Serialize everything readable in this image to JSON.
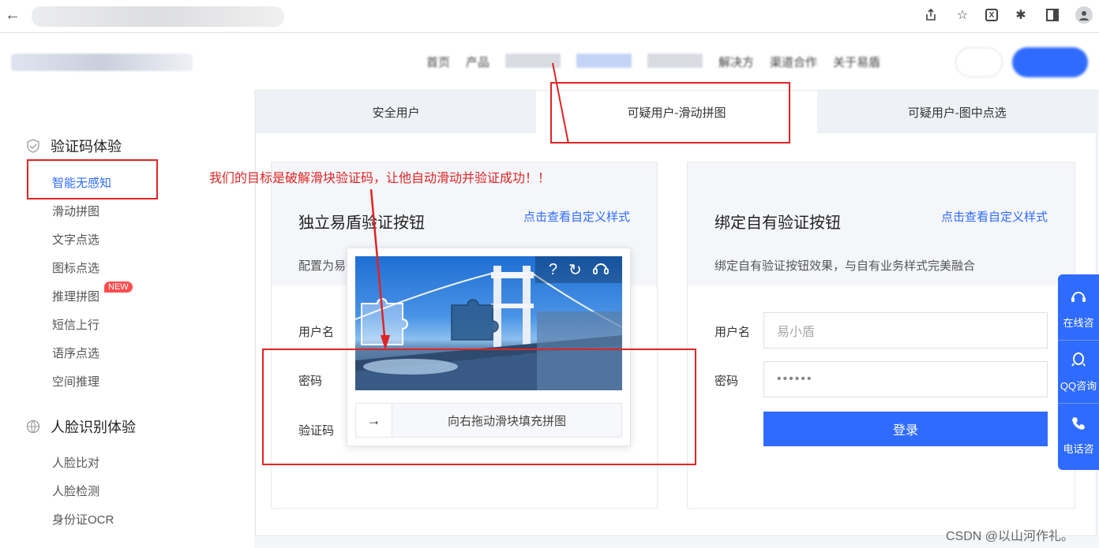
{
  "browser": {
    "back_icon": "←",
    "icons": [
      "share-icon",
      "star-icon",
      "excel-extension-icon",
      "puzzle-extension-icon",
      "sidepanel-icon",
      "profile-avatar-icon"
    ]
  },
  "header": {
    "nav": [
      "首页",
      "产品",
      "解决方",
      "渠道合作",
      "关于易盾"
    ]
  },
  "sidebar": {
    "group1_title": "验证码体验",
    "group1_items": [
      "智能无感知",
      "滑动拼图",
      "文字点选",
      "图标点选",
      "推理拼图",
      "短信上行",
      "语序点选",
      "空间推理"
    ],
    "new_badge": "NEW",
    "group2_title": "人脸识别体验",
    "group2_items": [
      "人脸比对",
      "人脸检测",
      "身份证OCR"
    ]
  },
  "tabs": [
    "安全用户",
    "可疑用户-滑动拼图",
    "可疑用户-图中点选"
  ],
  "card_left": {
    "title": "独立易盾验证按钮",
    "link": "点击查看自定义样式",
    "desc": "配置为易",
    "labels": {
      "username": "用户名",
      "password": "密码",
      "captcha": "验证码"
    }
  },
  "card_right": {
    "title": "绑定自有验证按钮",
    "link": "点击查看自定义样式",
    "desc": "绑定自有验证按钮效果，与自有业务样式完美融合",
    "labels": {
      "username": "用户名",
      "password": "密码"
    },
    "username_placeholder": "易小盾",
    "password_value": "••••••",
    "login": "登录"
  },
  "captcha": {
    "tools": [
      "?",
      "↻",
      "🎧"
    ],
    "slider_arrow": "→",
    "slider_text": "向右拖动滑块填充拼图"
  },
  "annotation": "我们的目标是破解滑块验证码，让他自动滑动并验证成功！！",
  "float_panel": [
    {
      "icon": "headset-icon",
      "label": "在线咨"
    },
    {
      "icon": "qq-icon",
      "label": "QQ咨询"
    },
    {
      "icon": "phone-icon",
      "label": "电话咨"
    }
  ],
  "watermark": "CSDN @以山河作礼。",
  "colors": {
    "primary": "#2f6bff",
    "annotation": "#e02424"
  }
}
